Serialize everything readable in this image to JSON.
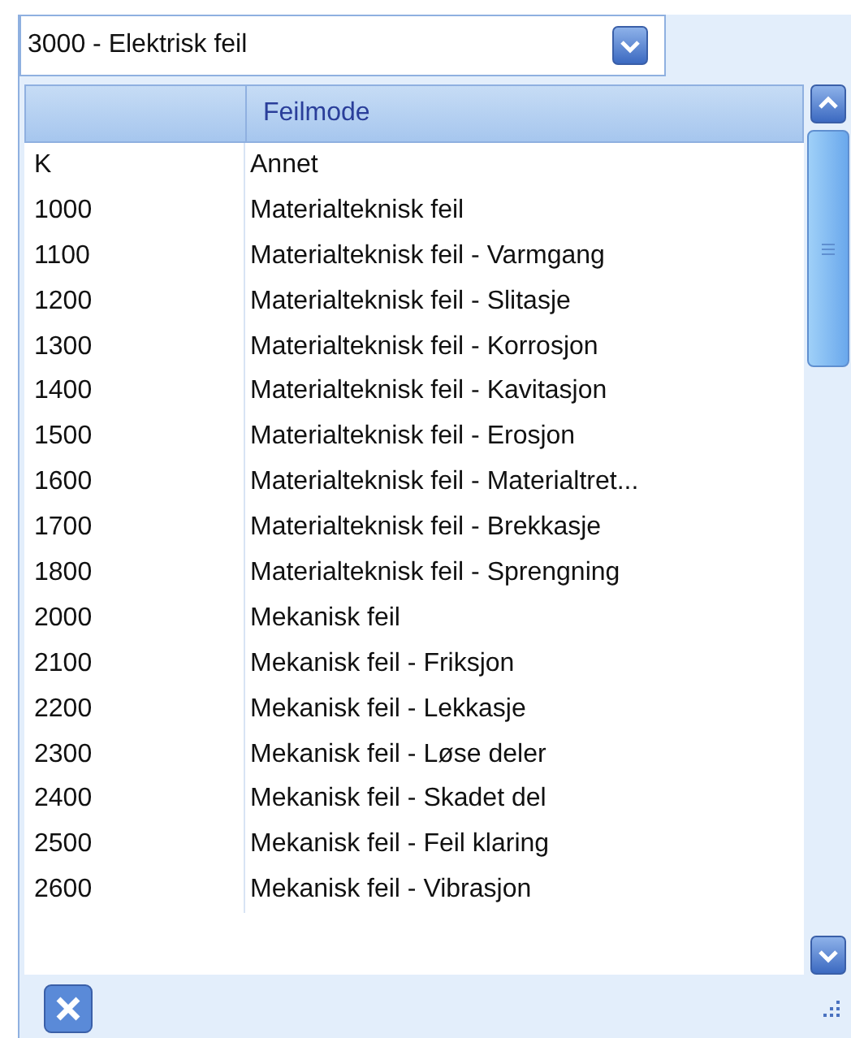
{
  "combo": {
    "value": "3000 - Elektrisk feil"
  },
  "table": {
    "columns": [
      "",
      "Feilmode"
    ],
    "rows": [
      {
        "code": "K",
        "mode": "Annet"
      },
      {
        "code": "1000",
        "mode": "Materialteknisk feil"
      },
      {
        "code": "1100",
        "mode": "Materialteknisk feil - Varmgang"
      },
      {
        "code": "1200",
        "mode": "Materialteknisk feil - Slitasje"
      },
      {
        "code": "1300",
        "mode": "Materialteknisk feil - Korrosjon"
      },
      {
        "code": "1400",
        "mode": "Materialteknisk feil - Kavitasjon"
      },
      {
        "code": "1500",
        "mode": "Materialteknisk feil - Erosjon"
      },
      {
        "code": "1600",
        "mode": "Materialteknisk feil - Materialtret..."
      },
      {
        "code": "1700",
        "mode": "Materialteknisk feil - Brekkasje"
      },
      {
        "code": "1800",
        "mode": "Materialteknisk feil - Sprengning"
      },
      {
        "code": "2000",
        "mode": "Mekanisk feil"
      },
      {
        "code": "2100",
        "mode": "Mekanisk feil - Friksjon"
      },
      {
        "code": "2200",
        "mode": "Mekanisk feil - Lekkasje"
      },
      {
        "code": "2300",
        "mode": "Mekanisk feil - Løse deler"
      },
      {
        "code": "2400",
        "mode": "Mekanisk feil - Skadet del"
      },
      {
        "code": "2500",
        "mode": "Mekanisk feil - Feil klaring"
      },
      {
        "code": "2600",
        "mode": "Mekanisk feil - Vibrasjon"
      }
    ]
  }
}
